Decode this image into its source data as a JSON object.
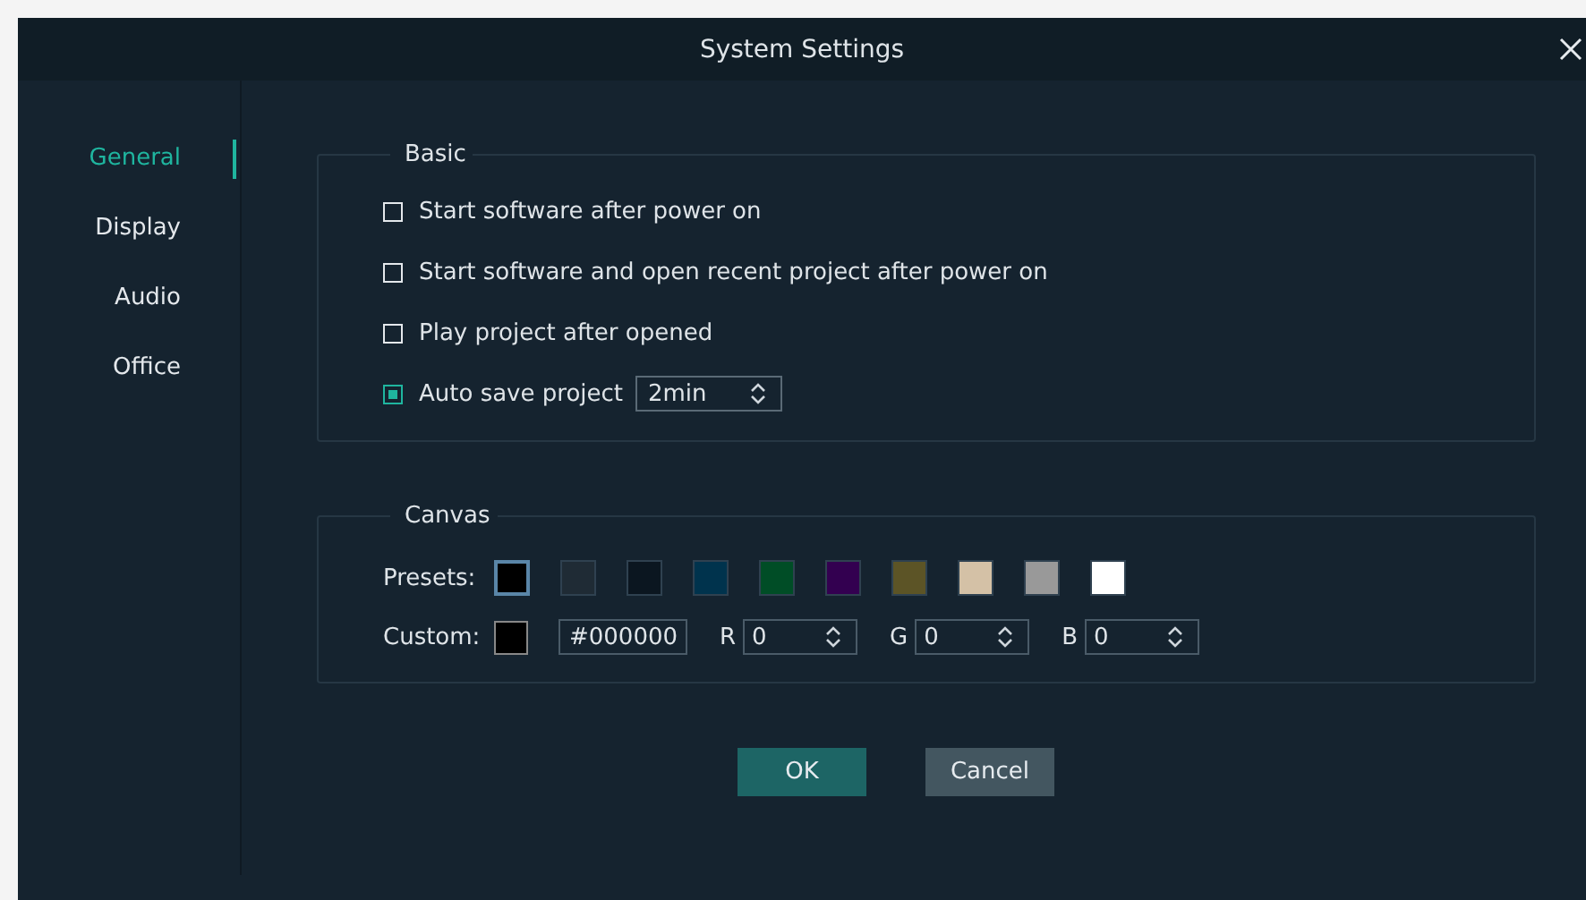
{
  "window": {
    "title": "System Settings"
  },
  "sidebar": {
    "items": [
      {
        "label": "General",
        "selected": true
      },
      {
        "label": "Display",
        "selected": false
      },
      {
        "label": "Audio",
        "selected": false
      },
      {
        "label": "Office",
        "selected": false
      }
    ]
  },
  "basic": {
    "legend": "Basic",
    "options": [
      {
        "kind": "checkbox",
        "label": "Start software after power on",
        "checked": false
      },
      {
        "kind": "checkbox",
        "label": "Start software and open recent project after power on",
        "checked": false
      },
      {
        "kind": "checkbox",
        "label": "Play project after opened",
        "checked": false
      },
      {
        "kind": "checkbox_select",
        "label": "Auto save project",
        "checked": true,
        "value": "2min"
      }
    ]
  },
  "canvas": {
    "legend": "Canvas",
    "presets_label": "Presets:",
    "presets": [
      {
        "color": "#000000",
        "selected": true
      },
      {
        "color": "#1f2b35",
        "selected": false
      },
      {
        "color": "#0b1620",
        "selected": false
      },
      {
        "color": "#00334d",
        "selected": false
      },
      {
        "color": "#004d26",
        "selected": false
      },
      {
        "color": "#330050",
        "selected": false
      },
      {
        "color": "#5c5426",
        "selected": false
      },
      {
        "color": "#d4c1a6",
        "selected": false
      },
      {
        "color": "#999999",
        "selected": false
      },
      {
        "color": "#ffffff",
        "selected": false
      }
    ],
    "custom_label": "Custom:",
    "hex": "#000000",
    "channels": [
      {
        "label": "R",
        "value": "0"
      },
      {
        "label": "G",
        "value": "0"
      },
      {
        "label": "B",
        "value": "0"
      }
    ]
  },
  "buttons": [
    {
      "label": "OK",
      "kind": "primary"
    },
    {
      "label": "Cancel",
      "kind": "secondary"
    }
  ]
}
